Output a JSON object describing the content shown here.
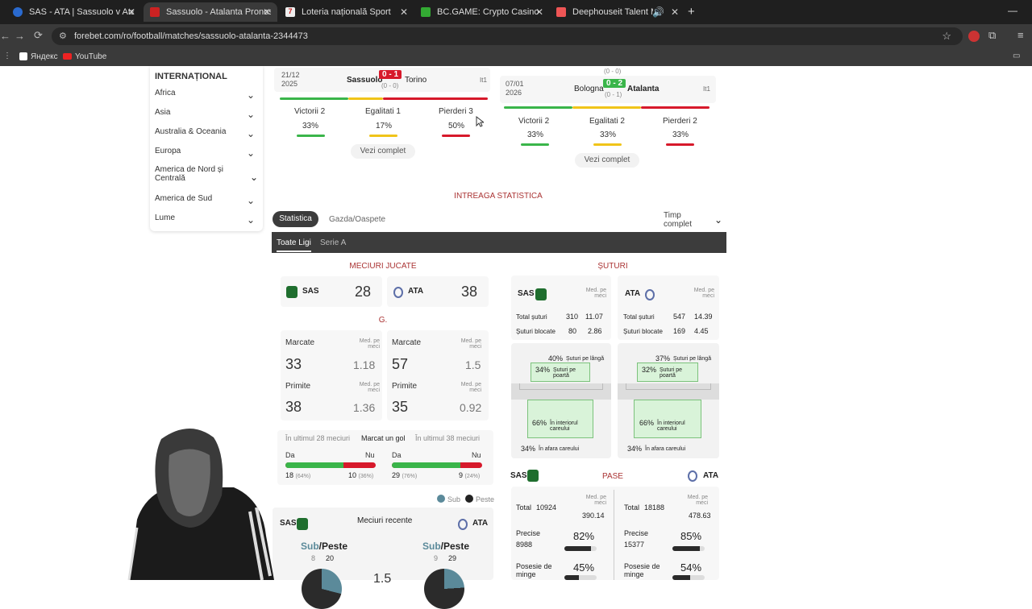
{
  "browser": {
    "tabs": [
      {
        "title": "SAS - ATA | Sassuolo v Atalanta",
        "fav": "#d33"
      },
      {
        "title": "Sassuolo - Atalanta Pronosticuri",
        "fav": "#c22"
      },
      {
        "title": "Loteria națională Sport",
        "fav": "#d22"
      },
      {
        "title": "BC.GAME: Crypto Casino Games",
        "fav": "#3a3"
      },
      {
        "title": "Deephouseit Talent Mix - dj",
        "fav": "#e55"
      }
    ],
    "url": "forebet.com/ro/football/matches/sassuolo-atalanta-2344473",
    "bookmarks": [
      "Яндекс",
      "YouTube"
    ]
  },
  "sidebar": {
    "title": "INTERNAȚIONAL",
    "items": [
      "Africa",
      "Asia",
      "Australia & Oceania",
      "Europa",
      "America de Nord și Centrală",
      "America de Sud",
      "Lume"
    ]
  },
  "left_match": {
    "date": "21/12",
    "year": "2025",
    "home": "Sassuolo",
    "score": "0 - 1",
    "ht": "(0 - 0)",
    "away": "Torino",
    "league": "It1"
  },
  "right_match": {
    "date": "07/01",
    "year": "2026",
    "top_ht": "(0 - 0)",
    "home": "Bologna",
    "score": "0 - 2",
    "ht": "(0 - 1)",
    "away": "Atalanta",
    "league": "It1"
  },
  "left_form": {
    "w_label": "Victorii 2",
    "w_pct": "33%",
    "d_label": "Egalitati 1",
    "d_pct": "17%",
    "l_label": "Pierderi 3",
    "l_pct": "50%",
    "btn": "Vezi complet"
  },
  "right_form": {
    "w_label": "Victorii 2",
    "w_pct": "33%",
    "d_label": "Egalitati 2",
    "d_pct": "33%",
    "l_label": "Pierderi 2",
    "l_pct": "33%",
    "btn": "Vezi complet"
  },
  "stats": {
    "title": "INTREAGA STATISTICA",
    "tab1": "Statistica",
    "tab2": "Gazda/Oaspete",
    "period": "Timp complet",
    "sub1": "Toate Ligi",
    "sub2": "Serie A"
  },
  "matches_played": {
    "title": "MECIURI JUCATE",
    "home": "SAS",
    "home_val": "28",
    "away": "ATA",
    "away_val": "38"
  },
  "goals": {
    "title": "G.",
    "scored": "Marcate",
    "conceded": "Primite",
    "avg": "Med. pe meci",
    "home_scored": "33",
    "home_scored_avg": "1.18",
    "home_conceded": "38",
    "home_conceded_avg": "1.36",
    "away_scored": "57",
    "away_scored_avg": "1.5",
    "away_conceded": "35",
    "away_conceded_avg": "0.92"
  },
  "scored_goal": {
    "left": "În ultimul 28 meciuri",
    "mid": "Marcat un gol",
    "right": "În ultimul 38 meciuri",
    "yes": "Da",
    "no": "Nu",
    "home_yes": "18",
    "home_yes_pct": "(64%)",
    "home_no": "10",
    "home_no_pct": "(36%)",
    "home_yes_frac": 0.64,
    "away_yes": "29",
    "away_yes_pct": "(76%)",
    "away_no": "9",
    "away_no_pct": "(24%)",
    "away_yes_frac": 0.76
  },
  "legend": {
    "under": "Sub",
    "over": "Peste"
  },
  "recent": {
    "title": "Meciuri recente",
    "home": "SAS",
    "away": "ATA",
    "sub": "Sub",
    "peste": "/Peste",
    "home_sub": "8",
    "home_over": "20",
    "away_sub": "9",
    "away_over": "29",
    "line": "1.5"
  },
  "shots": {
    "title": "ȘUTURI",
    "avg": "Med. pe meci",
    "home": "SAS",
    "away": "ATA",
    "total_label": "Total șuturi",
    "blocked_label": "Șuturi blocate",
    "home_total": "310",
    "home_total_avg": "11.07",
    "home_blocked": "80",
    "home_blocked_avg": "2.86",
    "away_total": "547",
    "away_total_avg": "14.39",
    "away_blocked": "169",
    "away_blocked_avg": "4.45",
    "wide_label": "Șuturi pe lângă",
    "on_label": "Șuturi pe poartă",
    "inside_label": "În interiorul careului",
    "outside_label": "În afara careului",
    "home_wide": "40%",
    "home_on": "34%",
    "home_inside": "66%",
    "home_outside": "34%",
    "away_wide": "37%",
    "away_on": "32%",
    "away_inside": "66%",
    "away_outside": "34%"
  },
  "passes": {
    "title": "PASE",
    "home": "SAS",
    "away": "ATA",
    "total_label": "Total",
    "avg": "Med. pe meci",
    "home_total": "10924",
    "home_total_avg": "390.14",
    "away_total": "18188",
    "away_total_avg": "478.63",
    "precise_label": "Precise",
    "home_precise": "8988",
    "home_precise_pct": "82%",
    "away_precise": "15377",
    "away_precise_pct": "85%",
    "home_precise_frac": 0.82,
    "away_precise_frac": 0.85,
    "poss_label": "Posesie de minge",
    "home_poss": "45%",
    "away_poss": "54%",
    "home_poss_frac": 0.45,
    "away_poss_frac": 0.54
  },
  "colors": {
    "green": "#3ab54a",
    "yellow": "#f0c419",
    "red": "#d7192b",
    "dark": "#3c3c3c",
    "accent": "#a3333d"
  }
}
